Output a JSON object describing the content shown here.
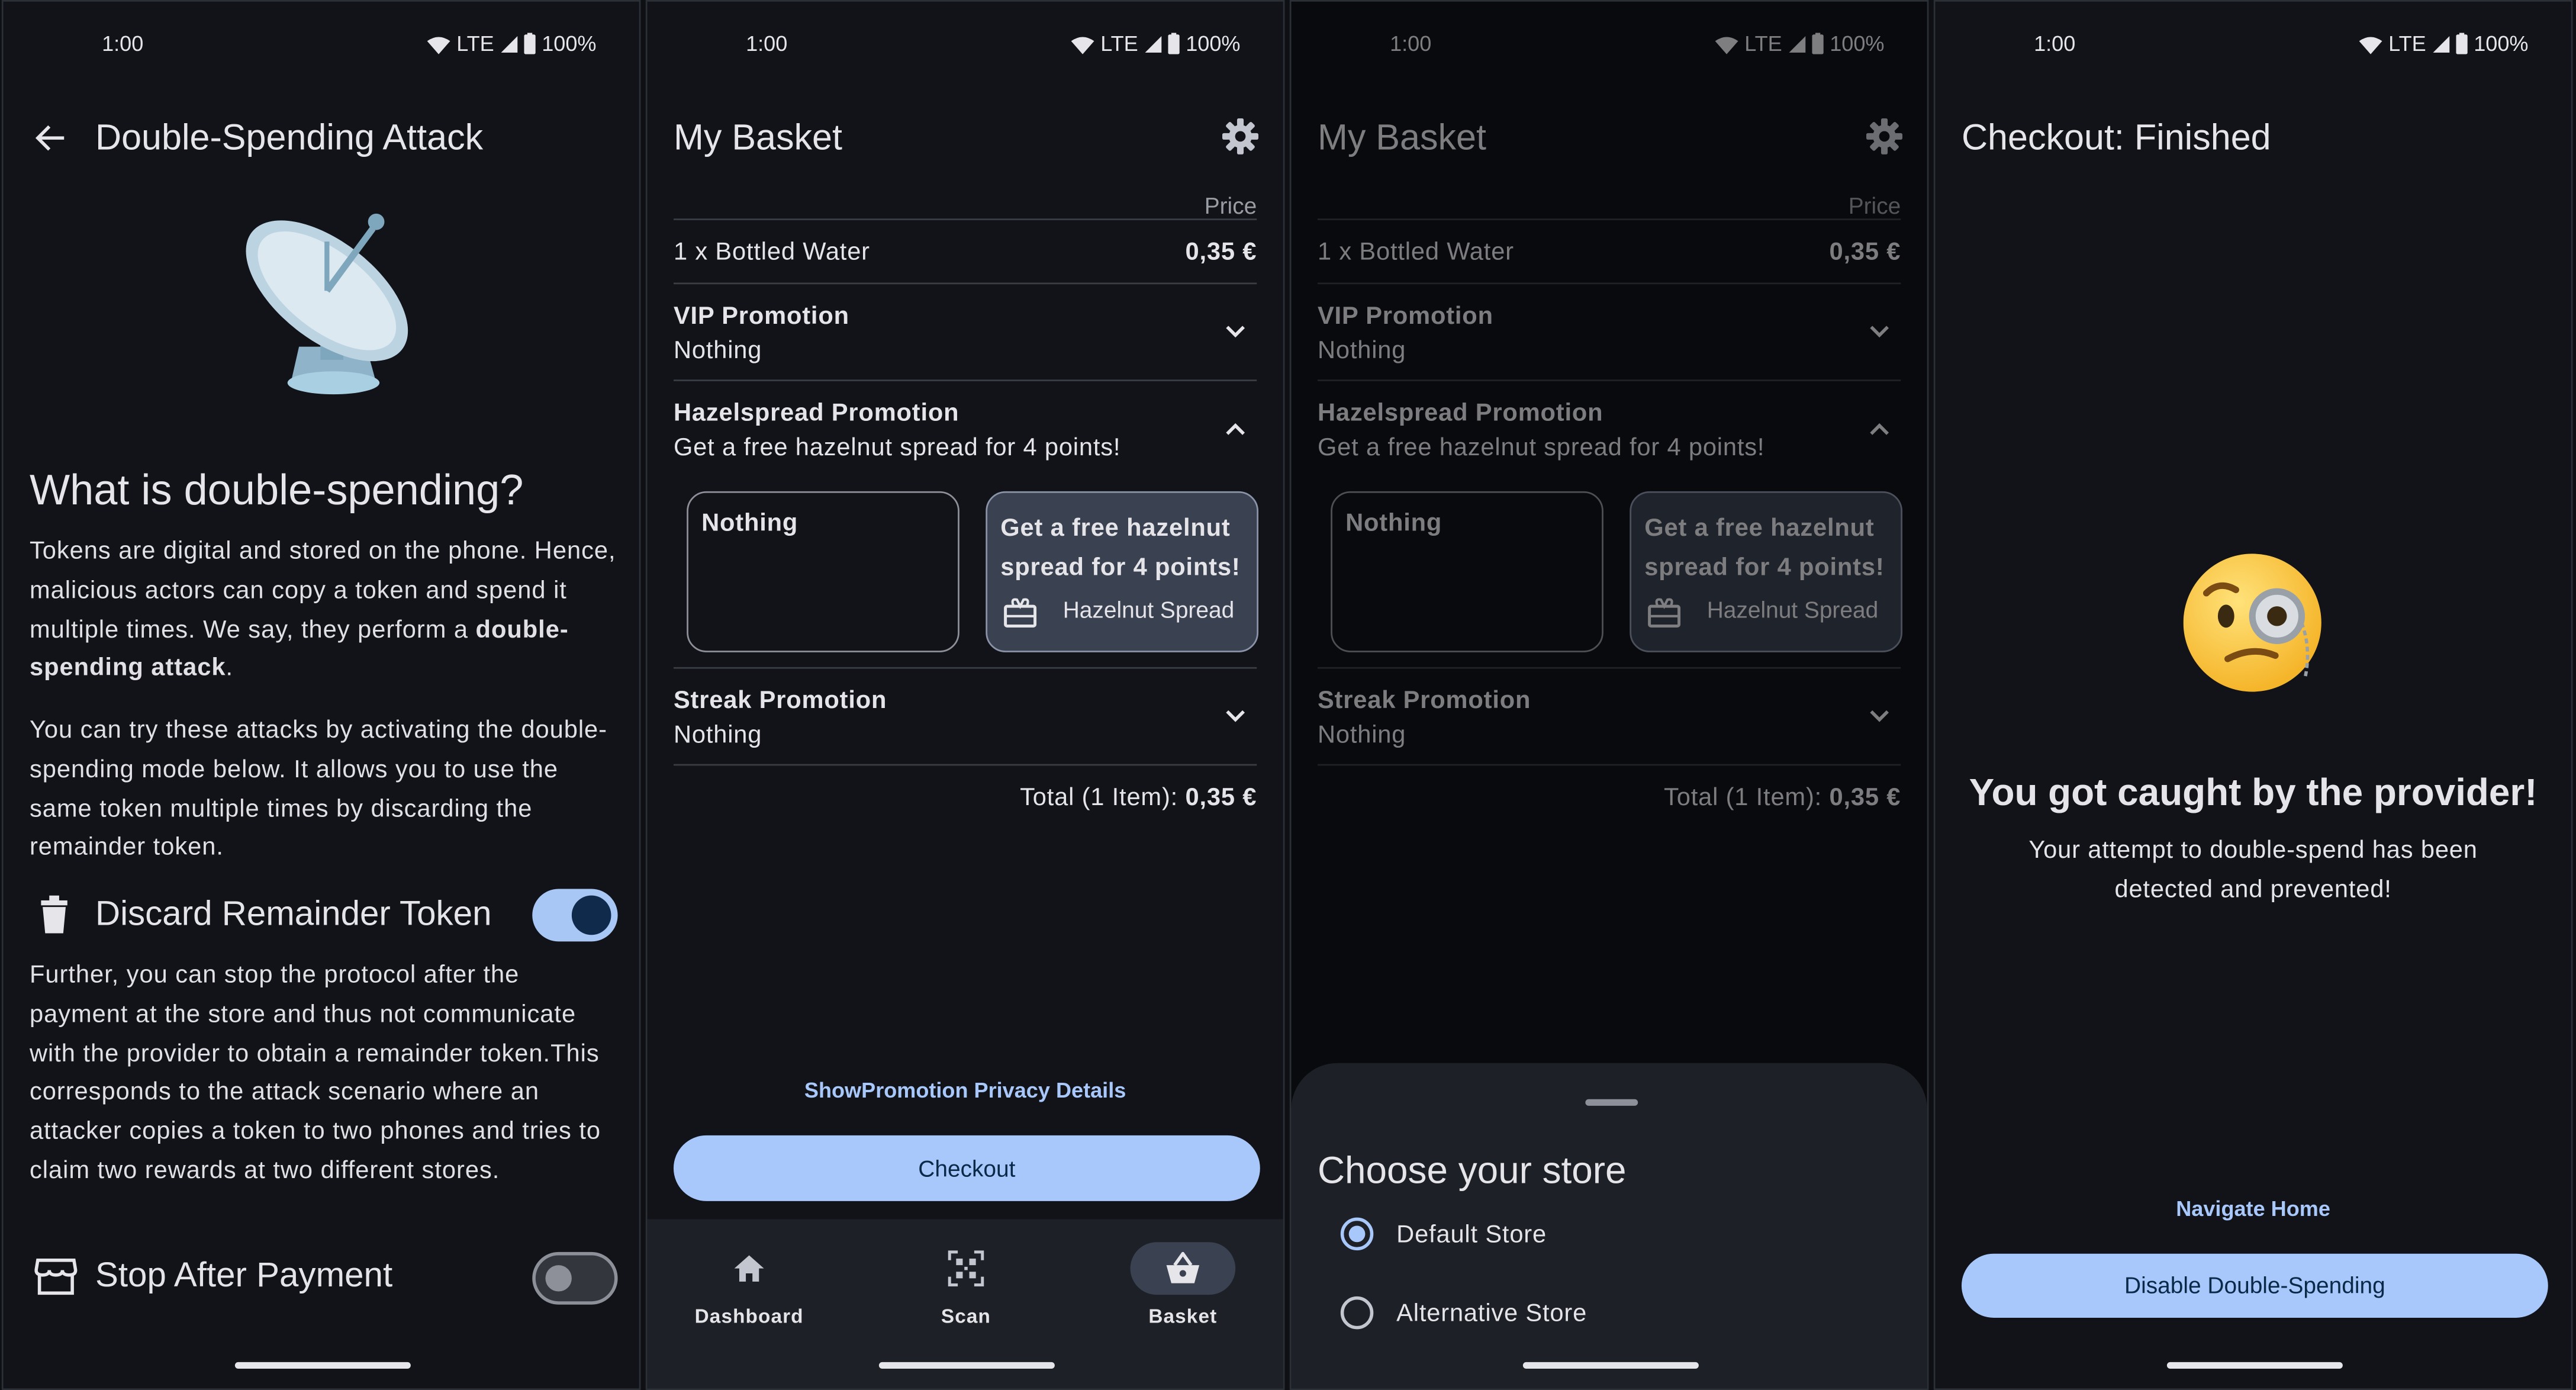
{
  "status": {
    "time": "1:00",
    "network": "LTE",
    "battery": "100%"
  },
  "screen1": {
    "title": "Double-Spending Attack",
    "heading": "What is double-spending?",
    "para1_pre": "Tokens are digital and stored on the phone. Hence, malicious actors can copy a token and spend it multiple times. We say, they perform a ",
    "para1_bold": "double-spending attack",
    "para1_post": ".",
    "para2": "You can try these attacks by activating the double-spending mode below. It allows you to use the same token multiple times by discarding the remainder token.",
    "discard_label": "Discard Remainder Token",
    "discard_on": true,
    "para3": "Further, you can stop the protocol after the payment at the store and thus not communicate with the provider to obtain a remainder token.This corresponds to the attack scenario where an attacker copies a token to two phones and tries to claim two rewards at two different stores.",
    "stop_label": "Stop After Payment",
    "stop_on": false,
    "icons": {
      "back": "arrow-left-icon",
      "image": "satellite-dish-icon",
      "discard": "trash-icon",
      "stop": "store-icon"
    }
  },
  "basket": {
    "title": "My Basket",
    "price_header": "Price",
    "item": "1 x Bottled Water",
    "item_price": "0,35 €",
    "vip_title": "VIP Promotion",
    "vip_value": "Nothing",
    "hazel_title": "Hazelspread Promotion",
    "hazel_value": "Get a free hazelnut spread for 4 points!",
    "option_nothing": "Nothing",
    "option_reward": "Get a free hazelnut spread for 4 points!",
    "option_reward_item": "Hazelnut Spread",
    "streak_title": "Streak Promotion",
    "streak_value": "Nothing",
    "total_label": "Total (1 Item):",
    "total_value": "0,35 €",
    "privacy_link": "ShowPromotion Privacy Details",
    "checkout": "Checkout",
    "nav": [
      {
        "label": "Dashboard",
        "icon": "home-icon"
      },
      {
        "label": "Scan",
        "icon": "qr-scan-icon"
      },
      {
        "label": "Basket",
        "icon": "basket-icon",
        "active": true
      }
    ]
  },
  "store_sheet": {
    "title": "Choose your store",
    "options": [
      "Default Store",
      "Alternative Store"
    ],
    "selected": "Default Store"
  },
  "finished": {
    "title": "Checkout: Finished",
    "heading": "You got caught by the provider!",
    "message": "Your attempt to double-spend has been detected and prevented!",
    "navigate_home": "Navigate Home",
    "disable_button": "Disable Double-Spending",
    "icon": "face-with-monocle-icon"
  },
  "colors": {
    "background": "#111318",
    "accent": "#a8c7fa",
    "accent_text": "#0a2847",
    "card_selected": "#3a4150",
    "navbar": "#1d2026"
  }
}
